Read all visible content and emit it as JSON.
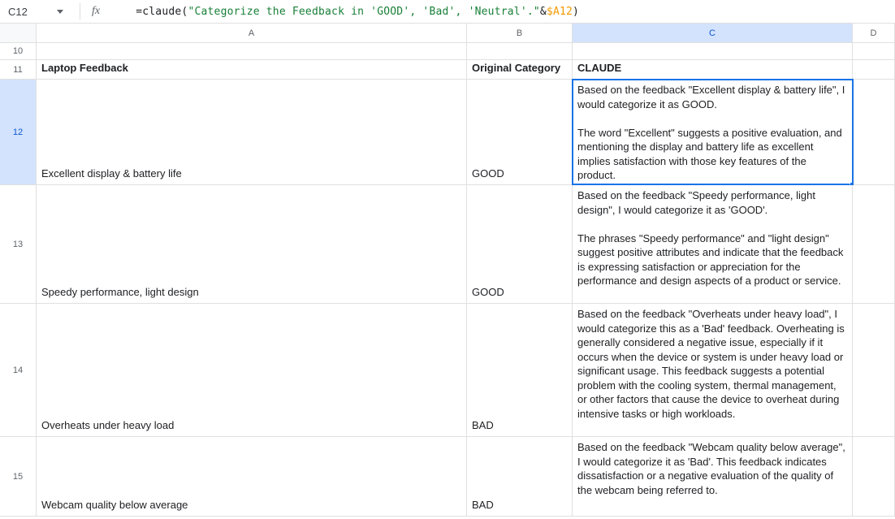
{
  "formula_bar": {
    "cell_ref": "C12",
    "prefix_eq": "=",
    "func_name": "claude",
    "open_paren": "(",
    "string_arg": "\"Categorize the Feedback in 'GOOD', 'Bad', 'Neutral'.\"",
    "amp": "&",
    "ref_arg": "$A12",
    "close_paren": ")"
  },
  "columns": {
    "A": "A",
    "B": "B",
    "C": "C",
    "D": "D"
  },
  "headers": {
    "feedback": "Laptop Feedback",
    "original": "Original Category",
    "claude": "CLAUDE"
  },
  "rows_meta": {
    "r10": "10",
    "r11": "11",
    "r12": "12",
    "r13": "13",
    "r14": "14",
    "r15": "15"
  },
  "data": {
    "r12": {
      "feedback": "Excellent display & battery life",
      "original": "GOOD",
      "claude": "Based on the feedback \"Excellent display & battery life\", I would categorize it as GOOD.\n\nThe word \"Excellent\" suggests a positive evaluation, and mentioning the display and battery life as excellent implies satisfaction with those key features of the product."
    },
    "r13": {
      "feedback": "Speedy performance, light design",
      "original": "GOOD",
      "claude": "Based on the feedback \"Speedy performance, light design\", I would categorize it as 'GOOD'.\n\nThe phrases \"Speedy performance\" and \"light design\" suggest positive attributes and indicate that the feedback is expressing satisfaction or appreciation for the performance and design aspects of a product or service."
    },
    "r14": {
      "feedback": "Overheats under heavy load",
      "original": "BAD",
      "claude": "Based on the feedback \"Overheats under heavy load\", I would categorize this as a 'Bad' feedback. Overheating is generally considered a negative issue, especially if it occurs when the device or system is under heavy load or significant usage. This feedback suggests a potential problem with the cooling system, thermal management, or other factors that cause the device to overheat during intensive tasks or high workloads."
    },
    "r15": {
      "feedback": "Webcam quality below average",
      "original": "BAD",
      "claude": "Based on the feedback \"Webcam quality below average\", I would categorize it as 'Bad'. This feedback indicates dissatisfaction or a negative evaluation of the quality of the webcam being referred to."
    }
  }
}
